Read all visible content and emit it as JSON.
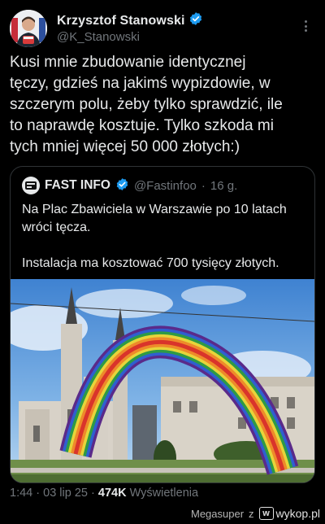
{
  "author": {
    "name": "Krzysztof Stanowski",
    "handle": "@K_Stanowski"
  },
  "tweet": {
    "text": "Kusi mnie zbudowanie identycznej\ntęczy, gdzieś na jakimś wypizdowie, w\nszczerym polu, żeby tylko sprawdzić, ile\nto naprawdę kosztuje. Tylko szkoda mi\ntych mniej więcej 50 000 złotych:)"
  },
  "quote": {
    "name": "FAST INFO",
    "handle": "@Fastinfoo",
    "separator": "·",
    "time": "16 g.",
    "text": "Na Plac Zbawiciela w Warszawie po 10 latach\nwróci tęcza.\n\nInstalacja ma kosztować 700 tysięcy złotych."
  },
  "meta": {
    "time": "1:44",
    "date": "03 lip 25",
    "views_count": "474K",
    "views_label": "Wyświetlenia",
    "separator": "·"
  },
  "footer": {
    "uploader": "Megasuper",
    "z": "z",
    "site_letter": "w",
    "site": "wykop.pl"
  },
  "colors": {
    "verified": "#1d9bf0",
    "background": "#000000",
    "secondary_text": "#71767b"
  }
}
